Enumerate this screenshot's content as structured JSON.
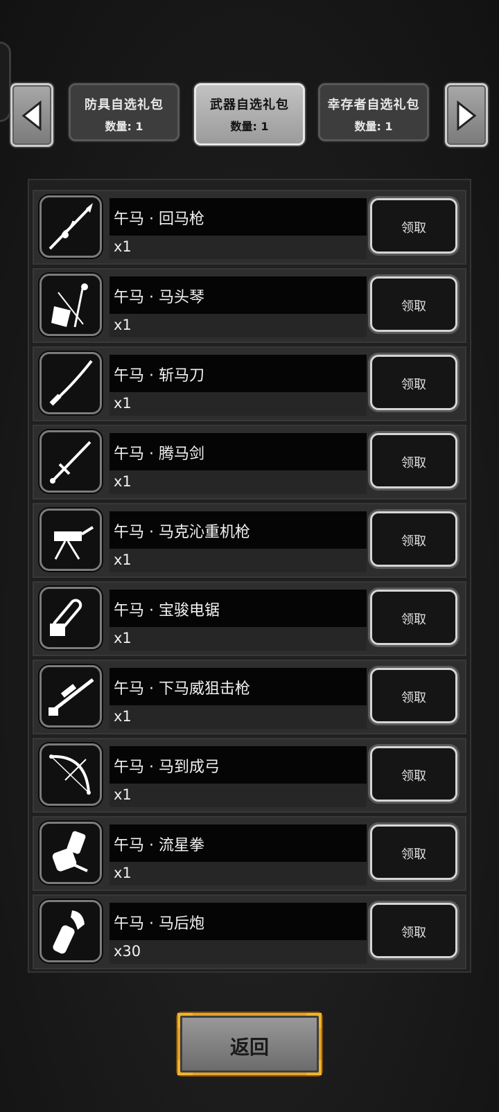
{
  "tabs": [
    {
      "title": "防具自选礼包",
      "count": "数量: 1",
      "active": false
    },
    {
      "title": "武器自选礼包",
      "count": "数量: 1",
      "active": true
    },
    {
      "title": "幸存者自选礼包",
      "count": "数量: 1",
      "active": false
    }
  ],
  "nav": {
    "left_icon": "triangle-left-icon",
    "right_icon": "triangle-right-icon"
  },
  "items": [
    {
      "name": "午马 · 回马枪",
      "qty": "x1",
      "icon": "spear-icon",
      "button": "领取"
    },
    {
      "name": "午马 · 马头琴",
      "qty": "x1",
      "icon": "horsehead-fiddle-icon",
      "button": "领取"
    },
    {
      "name": "午马 · 斩马刀",
      "qty": "x1",
      "icon": "saber-icon",
      "button": "领取"
    },
    {
      "name": "午马 · 腾马剑",
      "qty": "x1",
      "icon": "sword-icon",
      "button": "领取"
    },
    {
      "name": "午马 · 马克沁重机枪",
      "qty": "x1",
      "icon": "machine-gun-icon",
      "button": "领取"
    },
    {
      "name": "午马 · 宝骏电锯",
      "qty": "x1",
      "icon": "chainsaw-icon",
      "button": "领取"
    },
    {
      "name": "午马 · 下马威狙击枪",
      "qty": "x1",
      "icon": "sniper-rifle-icon",
      "button": "领取"
    },
    {
      "name": "午马 · 马到成弓",
      "qty": "x1",
      "icon": "bow-icon",
      "button": "领取"
    },
    {
      "name": "午马 · 流星拳",
      "qty": "x1",
      "icon": "gauntlet-icon",
      "button": "领取"
    },
    {
      "name": "午马 · 马后炮",
      "qty": "x30",
      "icon": "cannon-icon",
      "button": "领取"
    }
  ],
  "back_button": "返回",
  "colors": {
    "accent_gold": "#f0b429",
    "panel": "#202020",
    "row": "#2e2e2e"
  }
}
